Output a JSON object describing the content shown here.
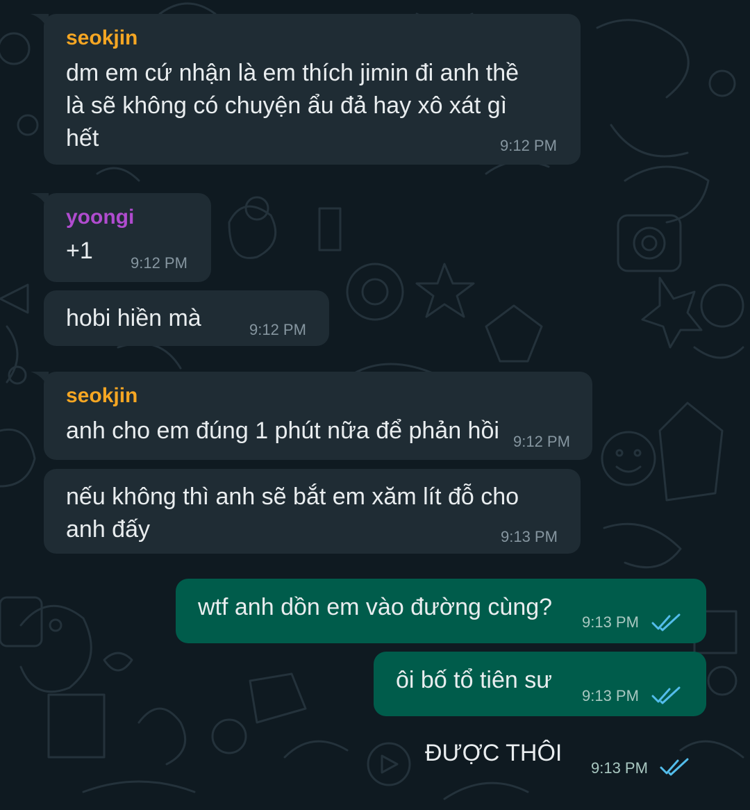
{
  "colors": {
    "background": "#0f1a21",
    "incoming_bubble": "#1f2c34",
    "outgoing_bubble": "#005c4b",
    "sender_seokjin": "#f5a623",
    "sender_yoongi": "#b04ccf",
    "read_ticks": "#53bdeb",
    "timestamp": "#8696a0"
  },
  "messages": [
    {
      "direction": "incoming",
      "sender": "seokjin",
      "lines": [
        "dm em cứ nhận là em thích jimin đi anh thề",
        "là sẽ không có chuyện ẩu đả hay xô xát gì",
        "hết"
      ],
      "time": "9:12 PM"
    },
    {
      "direction": "incoming",
      "sender": "yoongi",
      "lines": [
        "+1"
      ],
      "time": "9:12 PM"
    },
    {
      "direction": "incoming",
      "lines": [
        "hobi hiền mà"
      ],
      "time": "9:12 PM"
    },
    {
      "direction": "incoming",
      "sender": "seokjin",
      "lines": [
        "anh cho em đúng 1 phút nữa để phản hồi"
      ],
      "time": "9:12 PM"
    },
    {
      "direction": "incoming",
      "lines": [
        "nếu không thì anh sẽ bắt em xăm lít đỗ cho",
        "anh đấy"
      ],
      "time": "9:13 PM"
    },
    {
      "direction": "outgoing",
      "lines": [
        "wtf anh dồn em vào đường cùng?"
      ],
      "time": "9:13 PM",
      "status": "read"
    },
    {
      "direction": "outgoing",
      "lines": [
        "ôi bố tổ tiên sư"
      ],
      "time": "9:13 PM",
      "status": "read"
    },
    {
      "direction": "outgoing",
      "lines": [
        "ĐƯỢC THÔI"
      ],
      "time": "9:13 PM",
      "status": "read"
    }
  ]
}
